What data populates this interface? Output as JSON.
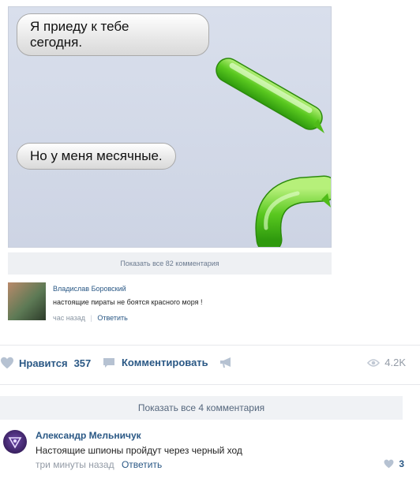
{
  "photo": {
    "bubble_1": "Я приеду к тебе\nсегодня.",
    "bubble_2": "Но у меня месячные."
  },
  "inner_post": {
    "show_all_comments": "Показать все 82 комментария",
    "comment": {
      "author": "Владислав Боровский",
      "text": "настоящие пираты не боятся красного моря !",
      "time": "час назад",
      "separator": "|",
      "reply": "Ответить"
    }
  },
  "actions": {
    "like_label": "Нравится",
    "like_count": "357",
    "comment_label": "Комментировать",
    "views_count": "4.2K"
  },
  "comments": {
    "show_all": "Показать все 4 комментария",
    "items": [
      {
        "author": "Александр Мельничук",
        "text": "Настоящие шпионы пройдут через черный ход",
        "time": "три минуты назад",
        "reply": "Ответить",
        "likes": "3"
      }
    ]
  },
  "colors": {
    "link": "#2a5885",
    "muted": "#939ba6",
    "bubble_green": "#5fcf2a"
  },
  "icons": [
    "heart-icon",
    "comment-icon",
    "megaphone-icon",
    "eye-icon"
  ]
}
